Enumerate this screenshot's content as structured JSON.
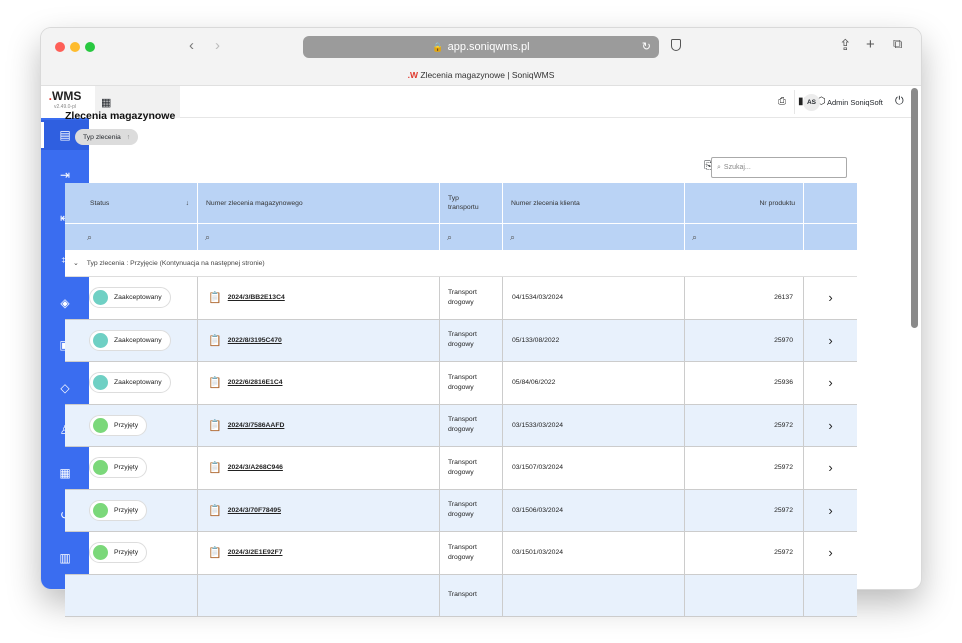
{
  "browser": {
    "url": "app.soniqwms.pl",
    "tab_logo": ".W",
    "tab_title": "Zlecenia magazynowe | SoniqWMS"
  },
  "app": {
    "logo_accent": ".",
    "logo_text": "WMS",
    "version": "v2.49.0-pl",
    "accent_color": "#3a6df0"
  },
  "sidebar": {
    "items": [
      {
        "icon": "clipboard-icon",
        "glyph": "▤",
        "active": true
      },
      {
        "icon": "inbound-icon",
        "glyph": "⇥",
        "active": false
      },
      {
        "icon": "outbound-icon",
        "glyph": "⇤",
        "active": false
      },
      {
        "icon": "scan-location-icon",
        "glyph": "⌗",
        "active": false
      },
      {
        "icon": "layers-icon",
        "glyph": "◈",
        "active": false
      },
      {
        "icon": "forklift-icon",
        "glyph": "▣",
        "active": false
      },
      {
        "icon": "diamond-icon",
        "glyph": "◇",
        "active": false
      },
      {
        "icon": "user-icon",
        "glyph": "♙",
        "active": false
      },
      {
        "icon": "contacts-icon",
        "glyph": "▦",
        "active": false
      },
      {
        "icon": "history-icon",
        "glyph": "↺",
        "active": false
      },
      {
        "icon": "warehouse-icon",
        "glyph": "▥",
        "active": false
      }
    ]
  },
  "topbar": {
    "user_initials": "AS",
    "user_name": "Admin SoniqSoft"
  },
  "page": {
    "title": "Zlecenia magazynowe",
    "group_chip": "Typ zlecenia",
    "search_placeholder": "Szukaj..."
  },
  "table": {
    "columns": {
      "status": "Status",
      "order_number": "Numer zlecenia magazynowego",
      "transport_type": "Typ transportu",
      "client_number": "Numer zlecenia klienta",
      "product_number": "Nr produktu"
    },
    "group_label": "Typ zlecenia : Przyjęcie (Kontynuacja na następnej stronie)",
    "rows": [
      {
        "status": "Zaakceptowany",
        "status_color": "#6fd0c4",
        "order": "2024/3/BB2E13C4",
        "transport": "Transport drogowy",
        "client": "04/1534/03/2024",
        "product": "26137"
      },
      {
        "status": "Zaakceptowany",
        "status_color": "#6fd0c4",
        "order": "2022/8/3195C470",
        "transport": "Transport drogowy",
        "client": "05/133/08/2022",
        "product": "25970"
      },
      {
        "status": "Zaakceptowany",
        "status_color": "#6fd0c4",
        "order": "2022/6/2816E1C4",
        "transport": "Transport drogowy",
        "client": "05/84/06/2022",
        "product": "25936"
      },
      {
        "status": "Przyjęty",
        "status_color": "#7bd87a",
        "order": "2024/3/7586AAFD",
        "transport": "Transport drogowy",
        "client": "03/1533/03/2024",
        "product": "25972"
      },
      {
        "status": "Przyjęty",
        "status_color": "#7bd87a",
        "order": "2024/3/A268C946",
        "transport": "Transport drogowy",
        "client": "03/1507/03/2024",
        "product": "25972"
      },
      {
        "status": "Przyjęty",
        "status_color": "#7bd87a",
        "order": "2024/3/70F78495",
        "transport": "Transport drogowy",
        "client": "03/1506/03/2024",
        "product": "25972"
      },
      {
        "status": "Przyjęty",
        "status_color": "#7bd87a",
        "order": "2024/3/2E1E92F7",
        "transport": "Transport drogowy",
        "client": "03/1501/03/2024",
        "product": "25972"
      },
      {
        "status": "",
        "status_color": "#7bd87a",
        "order": "",
        "transport": "Transport",
        "client": "",
        "product": ""
      }
    ]
  }
}
